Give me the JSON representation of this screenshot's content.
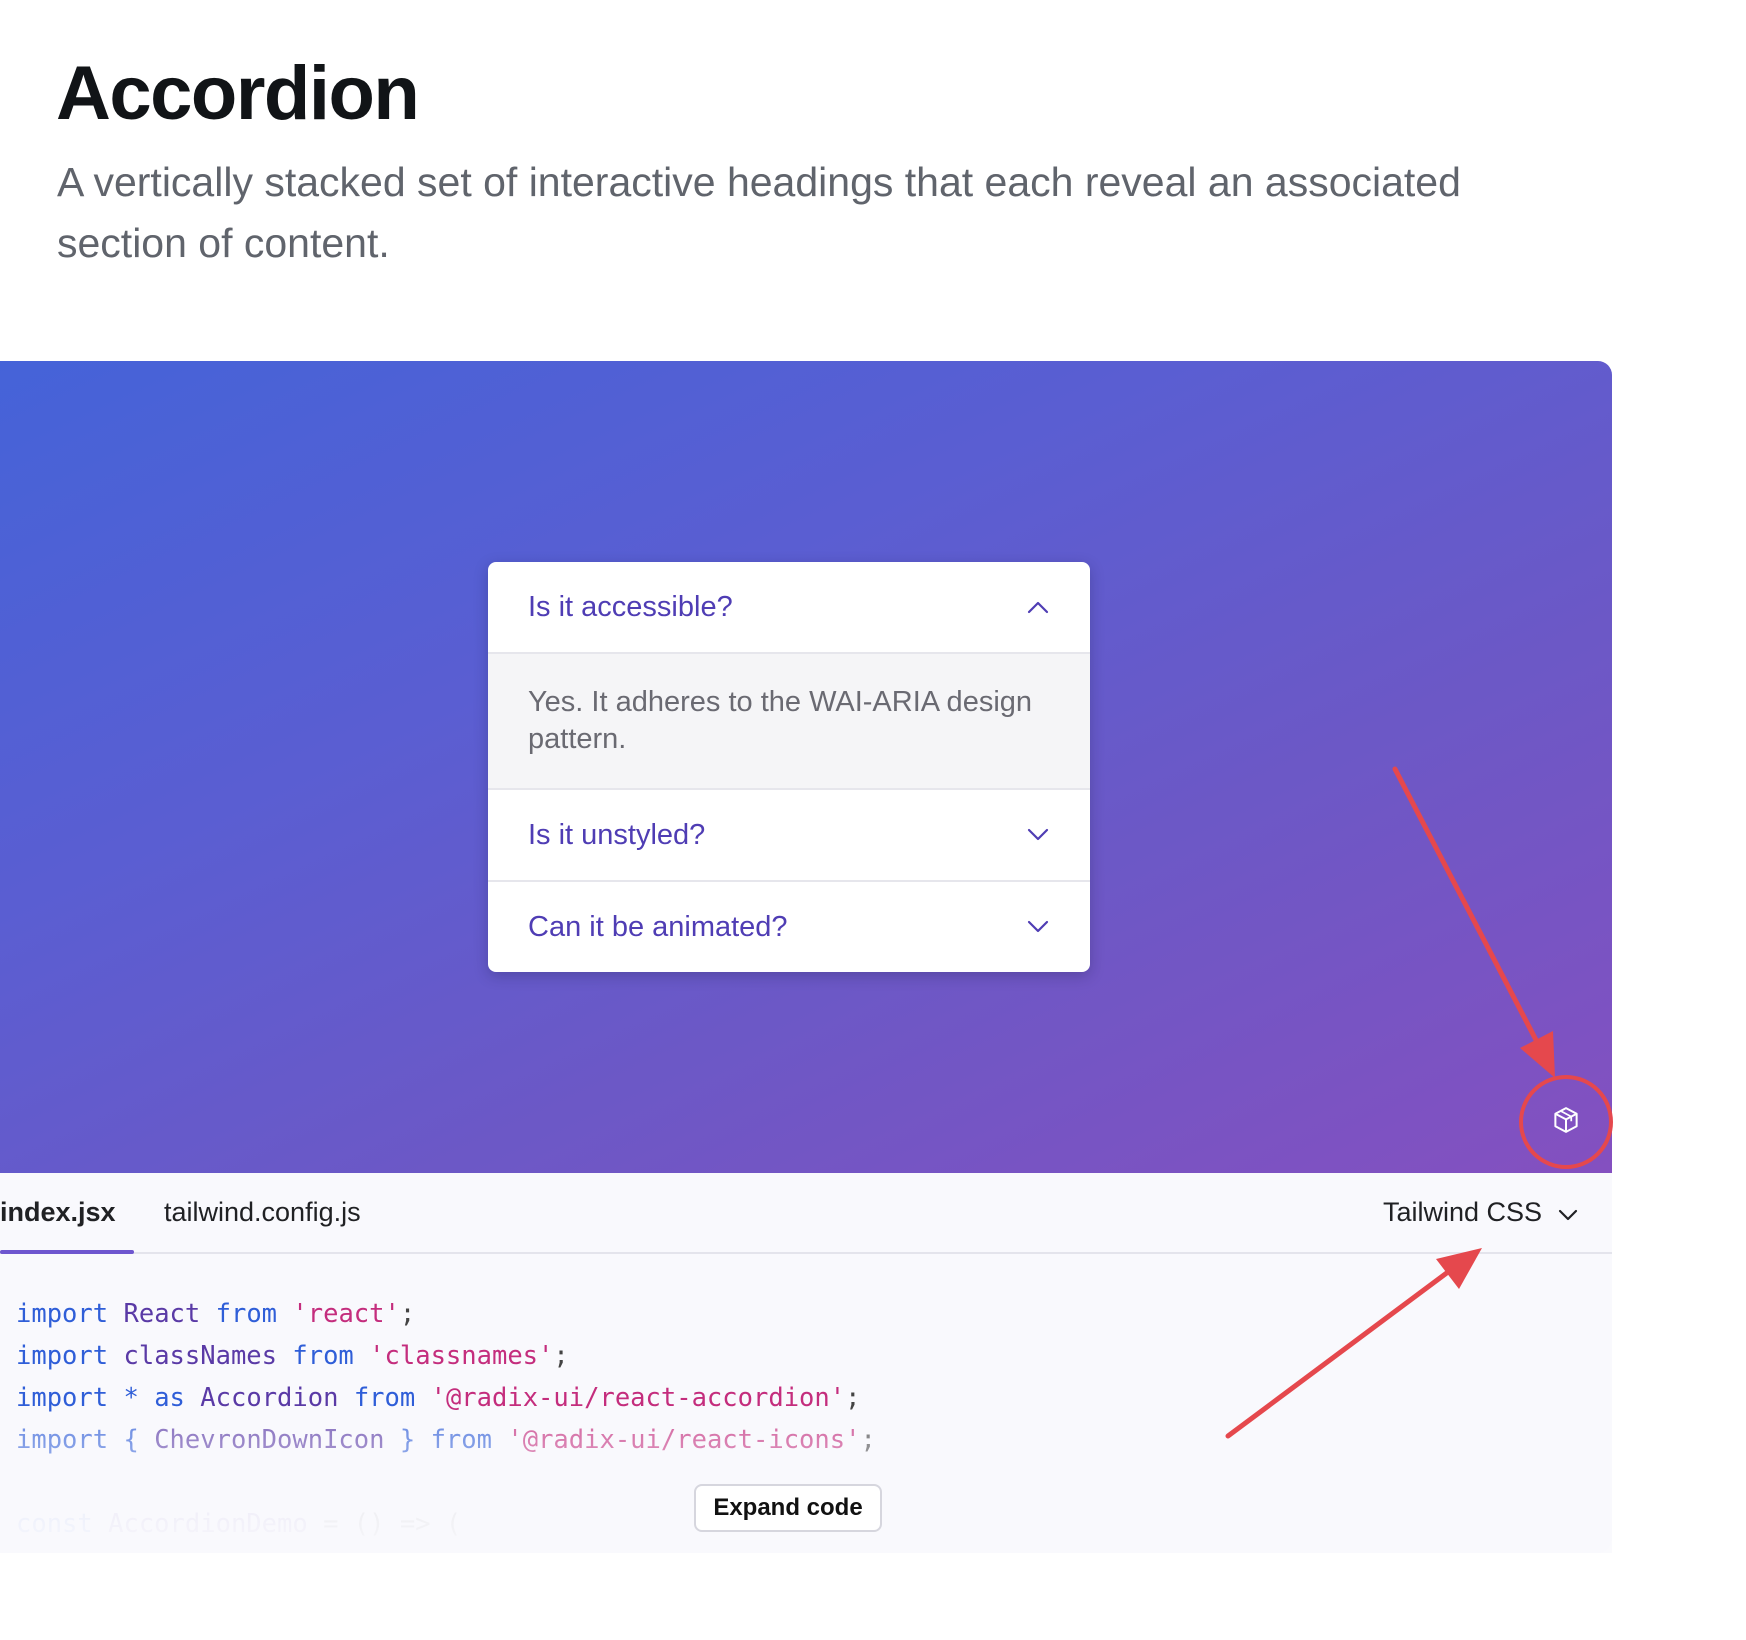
{
  "header": {
    "title": "Accordion",
    "description": "A vertically stacked set of interactive headings that each reveal an associated section of content."
  },
  "accordion": {
    "items": [
      {
        "trigger": "Is it accessible?",
        "content": "Yes. It adheres to the WAI-ARIA design pattern.",
        "open": true
      },
      {
        "trigger": "Is it unstyled?",
        "open": false
      },
      {
        "trigger": "Can it be animated?",
        "open": false
      }
    ]
  },
  "code_panel": {
    "tabs": [
      {
        "label": "index.jsx",
        "active": true
      },
      {
        "label": "tailwind.config.js",
        "active": false
      }
    ],
    "style_select": "Tailwind CSS",
    "lines": [
      [
        {
          "t": "kw",
          "v": "import"
        },
        {
          "t": "pun",
          "v": " "
        },
        {
          "t": "id",
          "v": "React"
        },
        {
          "t": "pun",
          "v": " "
        },
        {
          "t": "kw",
          "v": "from"
        },
        {
          "t": "pun",
          "v": " "
        },
        {
          "t": "str",
          "v": "'react'"
        },
        {
          "t": "pun",
          "v": ";"
        }
      ],
      [
        {
          "t": "kw",
          "v": "import"
        },
        {
          "t": "pun",
          "v": " "
        },
        {
          "t": "id",
          "v": "classNames"
        },
        {
          "t": "pun",
          "v": " "
        },
        {
          "t": "kw",
          "v": "from"
        },
        {
          "t": "pun",
          "v": " "
        },
        {
          "t": "str",
          "v": "'classnames'"
        },
        {
          "t": "pun",
          "v": ";"
        }
      ],
      [
        {
          "t": "kw",
          "v": "import"
        },
        {
          "t": "pun",
          "v": " "
        },
        {
          "t": "kw",
          "v": "*"
        },
        {
          "t": "pun",
          "v": " "
        },
        {
          "t": "kw",
          "v": "as"
        },
        {
          "t": "pun",
          "v": " "
        },
        {
          "t": "id",
          "v": "Accordion"
        },
        {
          "t": "pun",
          "v": " "
        },
        {
          "t": "kw",
          "v": "from"
        },
        {
          "t": "pun",
          "v": " "
        },
        {
          "t": "str",
          "v": "'@radix-ui/react-accordion'"
        },
        {
          "t": "pun",
          "v": ";"
        }
      ],
      [
        {
          "t": "kw",
          "v": "import"
        },
        {
          "t": "pun",
          "v": " "
        },
        {
          "t": "kw",
          "v": "{"
        },
        {
          "t": "pun",
          "v": " "
        },
        {
          "t": "id",
          "v": "ChevronDownIcon"
        },
        {
          "t": "pun",
          "v": " "
        },
        {
          "t": "kw",
          "v": "}"
        },
        {
          "t": "pun",
          "v": " "
        },
        {
          "t": "kw",
          "v": "from"
        },
        {
          "t": "pun",
          "v": " "
        },
        {
          "t": "str",
          "v": "'@radix-ui/react-icons'"
        },
        {
          "t": "pun",
          "v": ";"
        }
      ],
      [
        {
          "t": "kw",
          "v": "const"
        },
        {
          "t": "pun",
          "v": " "
        },
        {
          "t": "id",
          "v": "AccordionDemo"
        },
        {
          "t": "pun",
          "v": " = () => ("
        }
      ]
    ],
    "expand_label": "Expand code"
  },
  "colors": {
    "accent": "#6e56cf",
    "annotation": "#e5484d",
    "trigger_text": "#4f3db4"
  },
  "icons": {
    "demo_corner": "cube-icon",
    "open_item": "chevron-up-icon",
    "closed_item": "chevron-down-icon"
  }
}
